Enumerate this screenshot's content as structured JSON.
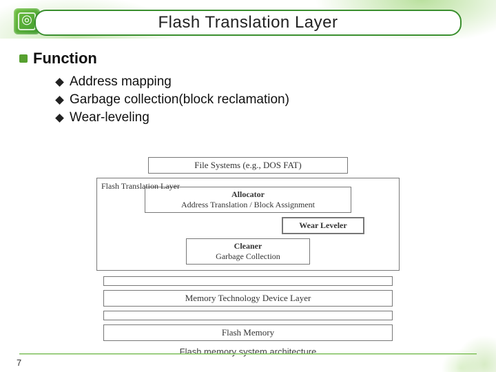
{
  "slide": {
    "title": "Flash Translation Layer",
    "page_number": "7"
  },
  "content": {
    "heading": "Function",
    "items": [
      "Address mapping",
      "Garbage collection(block reclamation)",
      "Wear-leveling"
    ]
  },
  "diagram": {
    "top_box": "File Systems (e.g., DOS FAT)",
    "ftl_label": "Flash Translation Layer",
    "allocator": {
      "title": "Allocator",
      "sub": "Address Translation / Block Assignment"
    },
    "wear_leveler": "Wear Leveler",
    "cleaner": {
      "title": "Cleaner",
      "sub": "Garbage Collection"
    },
    "mtd": "Memory Technology Device Layer",
    "flash": "Flash Memory",
    "caption": "Flash memory system architecture"
  }
}
